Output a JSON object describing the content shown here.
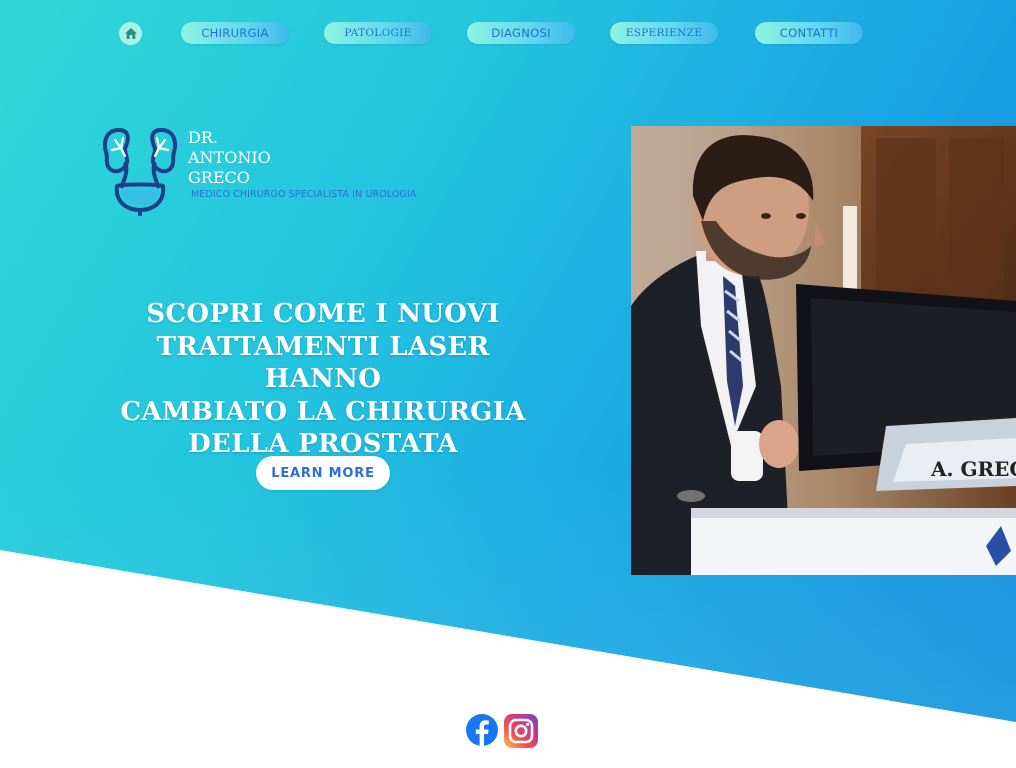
{
  "nav": {
    "items": [
      {
        "label": "CHIRURGIA"
      },
      {
        "label": "PATOLOGIE"
      },
      {
        "label": "DIAGNOSI"
      },
      {
        "label": "ESPERIENZE"
      },
      {
        "label": "CONTATTI"
      }
    ],
    "home_icon": "home-icon"
  },
  "brand": {
    "line1": "DR.",
    "line2": "ANTONIO",
    "line3": "GRECO",
    "subtitle": "MEDICO CHIRURGO SPECIALISTA IN UROLOGIA",
    "logo_icon": "kidney-bladder-icon"
  },
  "hero": {
    "headline_line1": "SCOPRI COME I NUOVI",
    "headline_line2": "TRATTAMENTI LASER HANNO",
    "headline_line3": "CAMBIATO LA CHIRURGIA",
    "headline_line4": "DELLA PROSTATA",
    "cta_label": "LEARN MORE"
  },
  "photo": {
    "nameplate": "A. GRECO"
  },
  "social": {
    "icons": [
      "facebook-icon",
      "instagram-icon"
    ]
  },
  "colors": {
    "gradient_start": "#2fd8d6",
    "gradient_end": "#1187df",
    "accent_blue": "#2d6fd6",
    "nav_pill": "#8ff3e0"
  }
}
